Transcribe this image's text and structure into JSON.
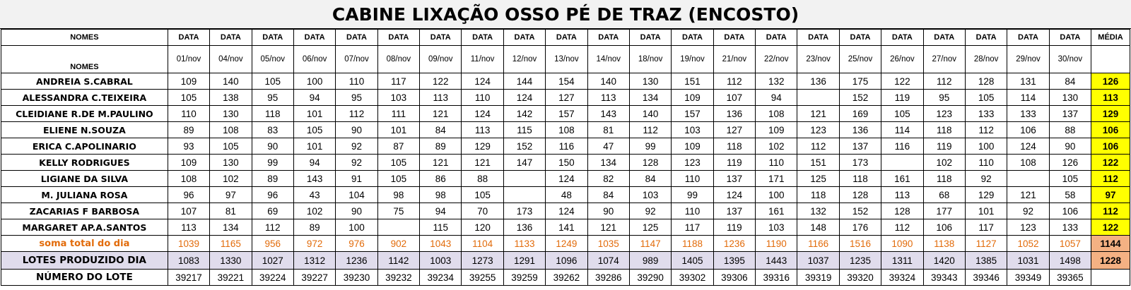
{
  "title": "CABINE LIXAÇÃO OSSO PÉ DE TRAZ (ENCOSTO)",
  "header": {
    "names_label": "NOMES",
    "date_label": "DATA",
    "average_label": "MÉDIA",
    "dates": [
      "01/nov",
      "04/nov",
      "05/nov",
      "06/nov",
      "07/nov",
      "08/nov",
      "09/nov",
      "11/nov",
      "12/nov",
      "13/nov",
      "14/nov",
      "18/nov",
      "19/nov",
      "21/nov",
      "22/nov",
      "23/nov",
      "25/nov",
      "26/nov",
      "27/nov",
      "28/nov",
      "29/nov",
      "30/nov"
    ]
  },
  "rows": [
    {
      "name": "ANDREIA S.CABRAL",
      "values": [
        "109",
        "140",
        "105",
        "100",
        "110",
        "117",
        "122",
        "124",
        "144",
        "154",
        "140",
        "130",
        "151",
        "112",
        "132",
        "136",
        "175",
        "122",
        "112",
        "128",
        "131",
        "84"
      ],
      "avg": "126"
    },
    {
      "name": "ALESSANDRA C.TEIXEIRA",
      "values": [
        "105",
        "138",
        "95",
        "94",
        "95",
        "103",
        "113",
        "110",
        "124",
        "127",
        "113",
        "134",
        "109",
        "107",
        "94",
        "",
        "152",
        "119",
        "95",
        "105",
        "114",
        "130"
      ],
      "avg": "113"
    },
    {
      "name": "CLEIDIANE R.DE M.PAULINO",
      "values": [
        "110",
        "130",
        "118",
        "101",
        "112",
        "111",
        "121",
        "124",
        "142",
        "157",
        "143",
        "140",
        "157",
        "136",
        "108",
        "121",
        "169",
        "105",
        "123",
        "133",
        "133",
        "137"
      ],
      "avg": "129"
    },
    {
      "name": "ELIENE N.SOUZA",
      "values": [
        "89",
        "108",
        "83",
        "105",
        "90",
        "101",
        "84",
        "113",
        "115",
        "108",
        "81",
        "112",
        "103",
        "127",
        "109",
        "123",
        "136",
        "114",
        "118",
        "112",
        "106",
        "88"
      ],
      "avg": "106"
    },
    {
      "name": "ERICA C.APOLINARIO",
      "values": [
        "93",
        "105",
        "90",
        "101",
        "92",
        "87",
        "89",
        "129",
        "152",
        "116",
        "47",
        "99",
        "109",
        "118",
        "102",
        "112",
        "137",
        "116",
        "119",
        "100",
        "124",
        "90"
      ],
      "avg": "106"
    },
    {
      "name": "KELLY RODRIGUES",
      "values": [
        "109",
        "130",
        "99",
        "94",
        "92",
        "105",
        "121",
        "121",
        "147",
        "150",
        "134",
        "128",
        "123",
        "119",
        "110",
        "151",
        "173",
        "",
        "102",
        "110",
        "108",
        "126"
      ],
      "avg": "122"
    },
    {
      "name": "LIGIANE DA SILVA",
      "values": [
        "108",
        "102",
        "89",
        "143",
        "91",
        "105",
        "86",
        "88",
        "",
        "124",
        "82",
        "84",
        "110",
        "137",
        "171",
        "125",
        "118",
        "161",
        "118",
        "92",
        "",
        "105"
      ],
      "avg": "112"
    },
    {
      "name": "M. JULIANA ROSA",
      "values": [
        "96",
        "97",
        "96",
        "43",
        "104",
        "98",
        "98",
        "105",
        "",
        "48",
        "84",
        "103",
        "99",
        "124",
        "100",
        "118",
        "128",
        "113",
        "68",
        "129",
        "121",
        "58"
      ],
      "avg": "97"
    },
    {
      "name": "ZACARIAS F BARBOSA",
      "values": [
        "107",
        "81",
        "69",
        "102",
        "90",
        "75",
        "94",
        "70",
        "173",
        "124",
        "90",
        "92",
        "110",
        "137",
        "161",
        "132",
        "152",
        "128",
        "177",
        "101",
        "92",
        "106"
      ],
      "avg": "112"
    },
    {
      "name": "MARGARET AP.A.SANTOS",
      "values": [
        "113",
        "134",
        "112",
        "89",
        "100",
        "",
        "115",
        "120",
        "136",
        "141",
        "121",
        "125",
        "117",
        "119",
        "103",
        "148",
        "176",
        "112",
        "106",
        "117",
        "123",
        "133"
      ],
      "avg": "122"
    }
  ],
  "soma": {
    "name": "soma total  do dia",
    "values": [
      "1039",
      "1165",
      "956",
      "972",
      "976",
      "902",
      "1043",
      "1104",
      "1133",
      "1249",
      "1035",
      "1147",
      "1188",
      "1236",
      "1190",
      "1166",
      "1516",
      "1090",
      "1138",
      "1127",
      "1052",
      "1057"
    ],
    "avg": "1144"
  },
  "lotes": {
    "name": "LOTES PRODUZIDO DIA",
    "values": [
      "1083",
      "1330",
      "1027",
      "1312",
      "1236",
      "1142",
      "1003",
      "1273",
      "1291",
      "1096",
      "1074",
      "989",
      "1405",
      "1395",
      "1443",
      "1037",
      "1235",
      "1311",
      "1420",
      "1385",
      "1031",
      "1498"
    ],
    "avg": "1228"
  },
  "lote_num": {
    "name": "NÚMERO DO LOTE",
    "values": [
      "39217",
      "39221",
      "39224",
      "39227",
      "39230",
      "39232",
      "39234",
      "39255",
      "39259",
      "39262",
      "39286",
      "39290",
      "39302",
      "39306",
      "39316",
      "39319",
      "39320",
      "39324",
      "39343",
      "39346",
      "39349",
      "39365"
    ],
    "avg": ""
  },
  "colors": {
    "average_highlight": "#ffff00",
    "sum_text": "#e26b0a",
    "total_avg_fill": "#f4b183",
    "lotes_row_fill": "#e0dcec"
  }
}
